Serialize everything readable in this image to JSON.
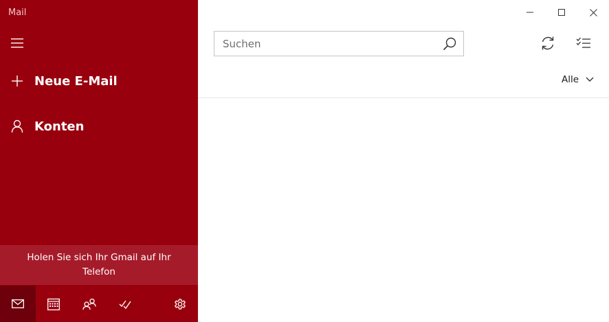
{
  "app": {
    "title": "Mail"
  },
  "sidebar": {
    "new_mail_label": "Neue E-Mail",
    "accounts_label": "Konten",
    "promo_text": "Holen Sie sich Ihr Gmail auf Ihr Telefon"
  },
  "search": {
    "placeholder": "Suchen",
    "value": ""
  },
  "filter": {
    "label": "Alle"
  },
  "colors": {
    "accent": "#99000e",
    "promo": "#a61b2a",
    "active_tab": "#6d000a"
  },
  "icons": {
    "menu": "hamburger-icon",
    "new_mail": "plus-icon",
    "accounts": "person-icon",
    "mail": "mail-icon",
    "calendar": "calendar-icon",
    "people": "people-icon",
    "todo": "todo-icon",
    "settings": "gear-icon",
    "search": "search-icon",
    "sync": "sync-icon",
    "select": "checklist-icon",
    "filter": "chevron-down-icon"
  }
}
